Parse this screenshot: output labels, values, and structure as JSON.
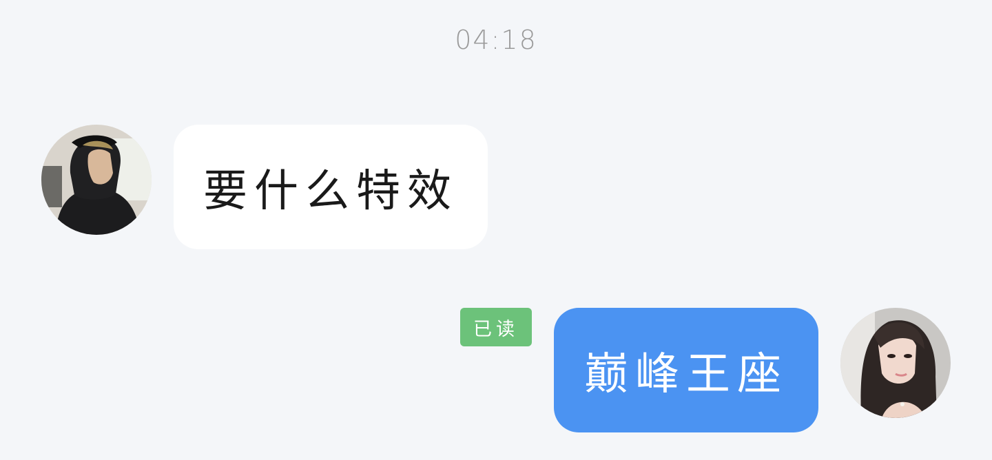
{
  "chat": {
    "timestamp": "04:18",
    "messages": [
      {
        "side": "left",
        "text": "要什么特效"
      },
      {
        "side": "right",
        "text": "巅峰王座",
        "status": "已读"
      }
    ]
  },
  "colors": {
    "background": "#f4f6f9",
    "incoming_bubble": "#ffffff",
    "outgoing_bubble": "#4b93f2",
    "read_badge": "#6cc27a",
    "timestamp_text": "#9a9a9a"
  }
}
